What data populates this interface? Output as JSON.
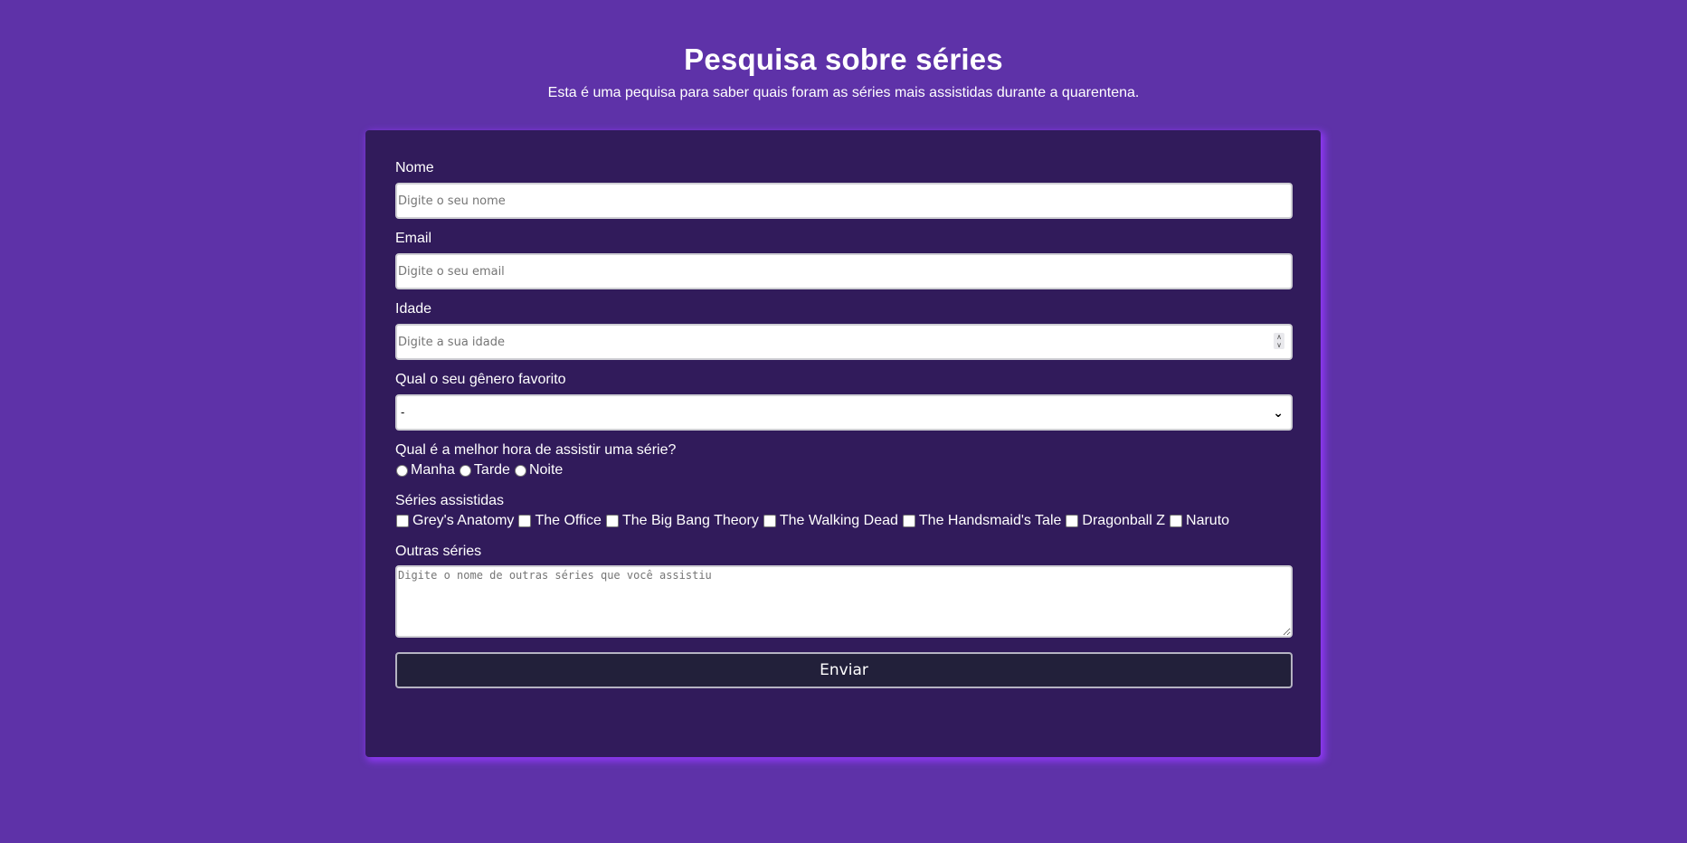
{
  "header": {
    "title": "Pesquisa sobre séries",
    "description": "Esta é uma pequisa para saber quais foram as séries mais assistidas durante a quarentena."
  },
  "form": {
    "name": {
      "label": "Nome",
      "placeholder": "Digite o seu nome",
      "value": ""
    },
    "email": {
      "label": "Email",
      "placeholder": "Digite o seu email",
      "value": ""
    },
    "age": {
      "label": "Idade",
      "placeholder": "Digite a sua idade",
      "value": ""
    },
    "genre": {
      "label": "Qual o seu gênero favorito",
      "selected": "-"
    },
    "best_time": {
      "label": "Qual é a melhor hora de assistir uma série?",
      "options": [
        "Manha",
        "Tarde",
        "Noite"
      ]
    },
    "watched_series": {
      "label": "Séries assistidas",
      "options": [
        "Grey's Anatomy",
        "The Office",
        "The Big Bang Theory",
        "The Walking Dead",
        "The Handsmaid's Tale",
        "Dragonball Z",
        "Naruto"
      ]
    },
    "other_series": {
      "label": "Outras séries",
      "placeholder": "Digite o nome de outras séries que você assistiu",
      "value": ""
    },
    "submit_label": "Enviar"
  },
  "colors": {
    "page_background": "#5e32a8",
    "card_background": "#311b5b",
    "card_glow": "#8c38f0",
    "button_background": "#22203a"
  }
}
